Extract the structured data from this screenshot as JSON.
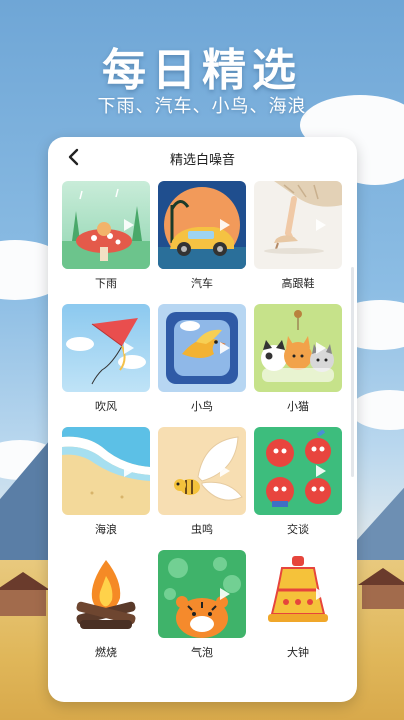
{
  "header": {
    "headline": "每日精选",
    "subline": "下雨、汽车、小鸟、海浪"
  },
  "card": {
    "title": "精选白噪音",
    "back_icon": "chevron-left-icon"
  },
  "sounds": [
    {
      "label": "下雨",
      "icon": "rain-mushroom-illustration"
    },
    {
      "label": "汽车",
      "icon": "car-illustration"
    },
    {
      "label": "高跟鞋",
      "icon": "high-heel-illustration"
    },
    {
      "label": "吹风",
      "icon": "kite-illustration"
    },
    {
      "label": "小鸟",
      "icon": "bird-illustration"
    },
    {
      "label": "小猫",
      "icon": "cats-illustration"
    },
    {
      "label": "海浪",
      "icon": "beach-wave-illustration"
    },
    {
      "label": "虫鸣",
      "icon": "bee-illustration"
    },
    {
      "label": "交谈",
      "icon": "apples-chatting-illustration"
    },
    {
      "label": "燃烧",
      "icon": "campfire-illustration"
    },
    {
      "label": "气泡",
      "icon": "tiger-bubbles-illustration"
    },
    {
      "label": "大钟",
      "icon": "bell-illustration"
    }
  ],
  "colors": {
    "sky": "#7fb3de",
    "card": "#ffffff",
    "text": "#222222"
  }
}
